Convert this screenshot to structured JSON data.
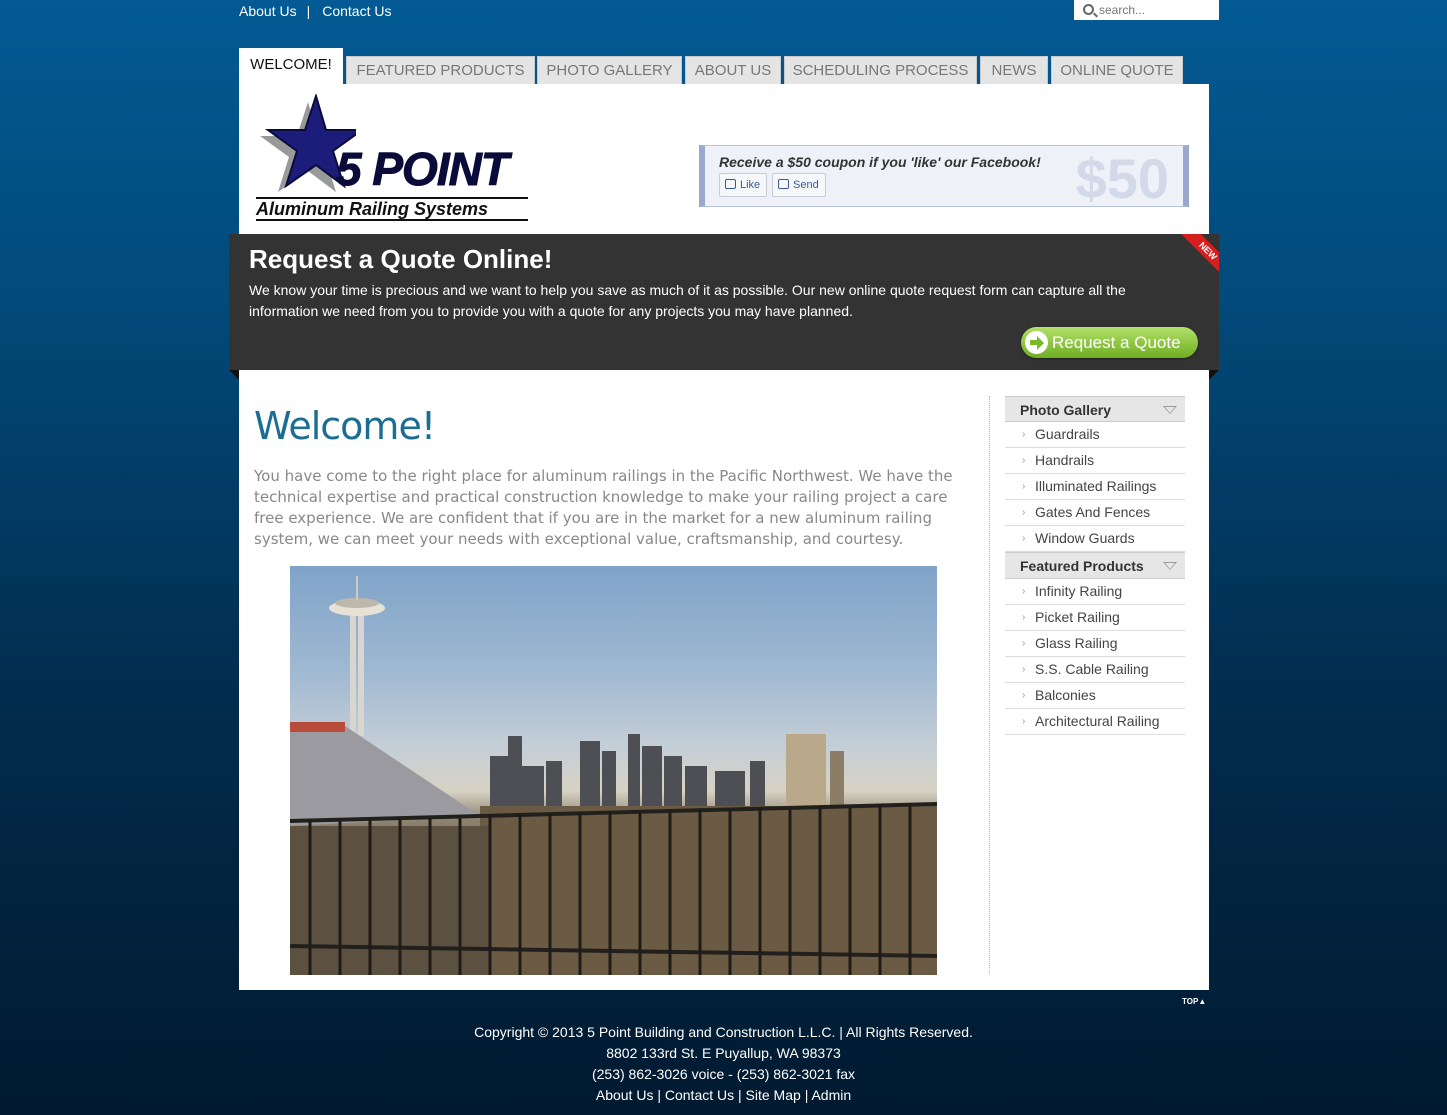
{
  "toplinks": {
    "about": "About Us",
    "separator": "|",
    "contact": "Contact Us"
  },
  "search": {
    "placeholder": "search..."
  },
  "tabs": [
    {
      "label": "WELCOME!",
      "active": true
    },
    {
      "label": "FEATURED PRODUCTS"
    },
    {
      "label": "PHOTO GALLERY"
    },
    {
      "label": "ABOUT US"
    },
    {
      "label": "SCHEDULING PROCESS"
    },
    {
      "label": "NEWS"
    },
    {
      "label": "ONLINE QUOTE"
    }
  ],
  "logo": {
    "brand": "5 POINT",
    "subtitle": "Aluminum Railing Systems"
  },
  "facebook": {
    "message": "Receive a $50 coupon if you 'like' our Facebook!",
    "like": "Like",
    "send": "Send",
    "amount": "$50"
  },
  "quote": {
    "title": "Request a Quote Online!",
    "body": "We know your time is precious and we want to help you save as much of it as possible. Our new online quote request form can capture all the information we need from you to provide you with a quote for any projects you may have planned.",
    "ribbon": "NEW",
    "button": "Request a Quote"
  },
  "main": {
    "heading": "Welcome!",
    "intro": "You have come to the right place for aluminum railings in the Pacific Northwest. We have the technical expertise and practical construction knowledge to make your railing project a care free experience. We are confident that if you are in the market for a new aluminum railing system, we can meet your needs with exceptional value, craftsmanship, and courtesy."
  },
  "sidebar": {
    "gallery": {
      "title": "Photo Gallery",
      "items": [
        "Guardrails",
        "Handrails",
        "Illuminated Railings",
        "Gates And Fences",
        "Window Guards"
      ]
    },
    "products": {
      "title": "Featured Products",
      "items": [
        "Infinity Railing",
        "Picket Railing",
        "Glass Railing",
        "S.S. Cable Railing",
        "Balconies",
        "Architectural Railing"
      ]
    }
  },
  "footer": {
    "top": "TOP",
    "copyright": "Copyright © 2013 5 Point Building and Construction L.L.C. | All Rights Reserved.",
    "address": "8802 133rd St. E Puyallup, WA 98373",
    "phone": "(253) 862-3026 voice - (253) 862-3021 fax",
    "links": {
      "about": "About Us",
      "contact": "Contact Us",
      "sitemap": "Site Map",
      "admin": "Admin",
      "sep": "|"
    }
  },
  "colors": {
    "accent": "#1b6d94",
    "band": "#333333",
    "button": "#79b92a",
    "ribbon": "#d51f1f"
  }
}
